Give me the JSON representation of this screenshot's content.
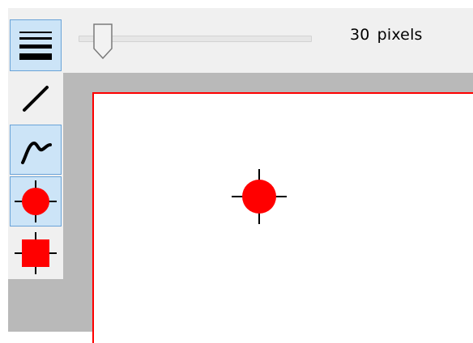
{
  "toolbar": {
    "tools": [
      {
        "name": "line-width-tool",
        "icon": "line-width-icon",
        "selected": true
      },
      {
        "name": "straight-line-tool",
        "icon": "diagonal-line-icon",
        "selected": false
      },
      {
        "name": "freehand-line-tool",
        "icon": "curve-line-icon",
        "selected": true
      },
      {
        "name": "circle-marker-tool",
        "icon": "red-circle-crosshair-icon",
        "selected": true
      },
      {
        "name": "square-marker-tool",
        "icon": "red-square-crosshair-icon",
        "selected": false
      }
    ]
  },
  "size_slider": {
    "value": "30",
    "unit": "pixels"
  },
  "colors": {
    "marker": "#ff0000",
    "canvas_border": "#ff0000",
    "selected_tool_bg": "#cce4f7",
    "selected_tool_border": "#6aa3d8"
  }
}
